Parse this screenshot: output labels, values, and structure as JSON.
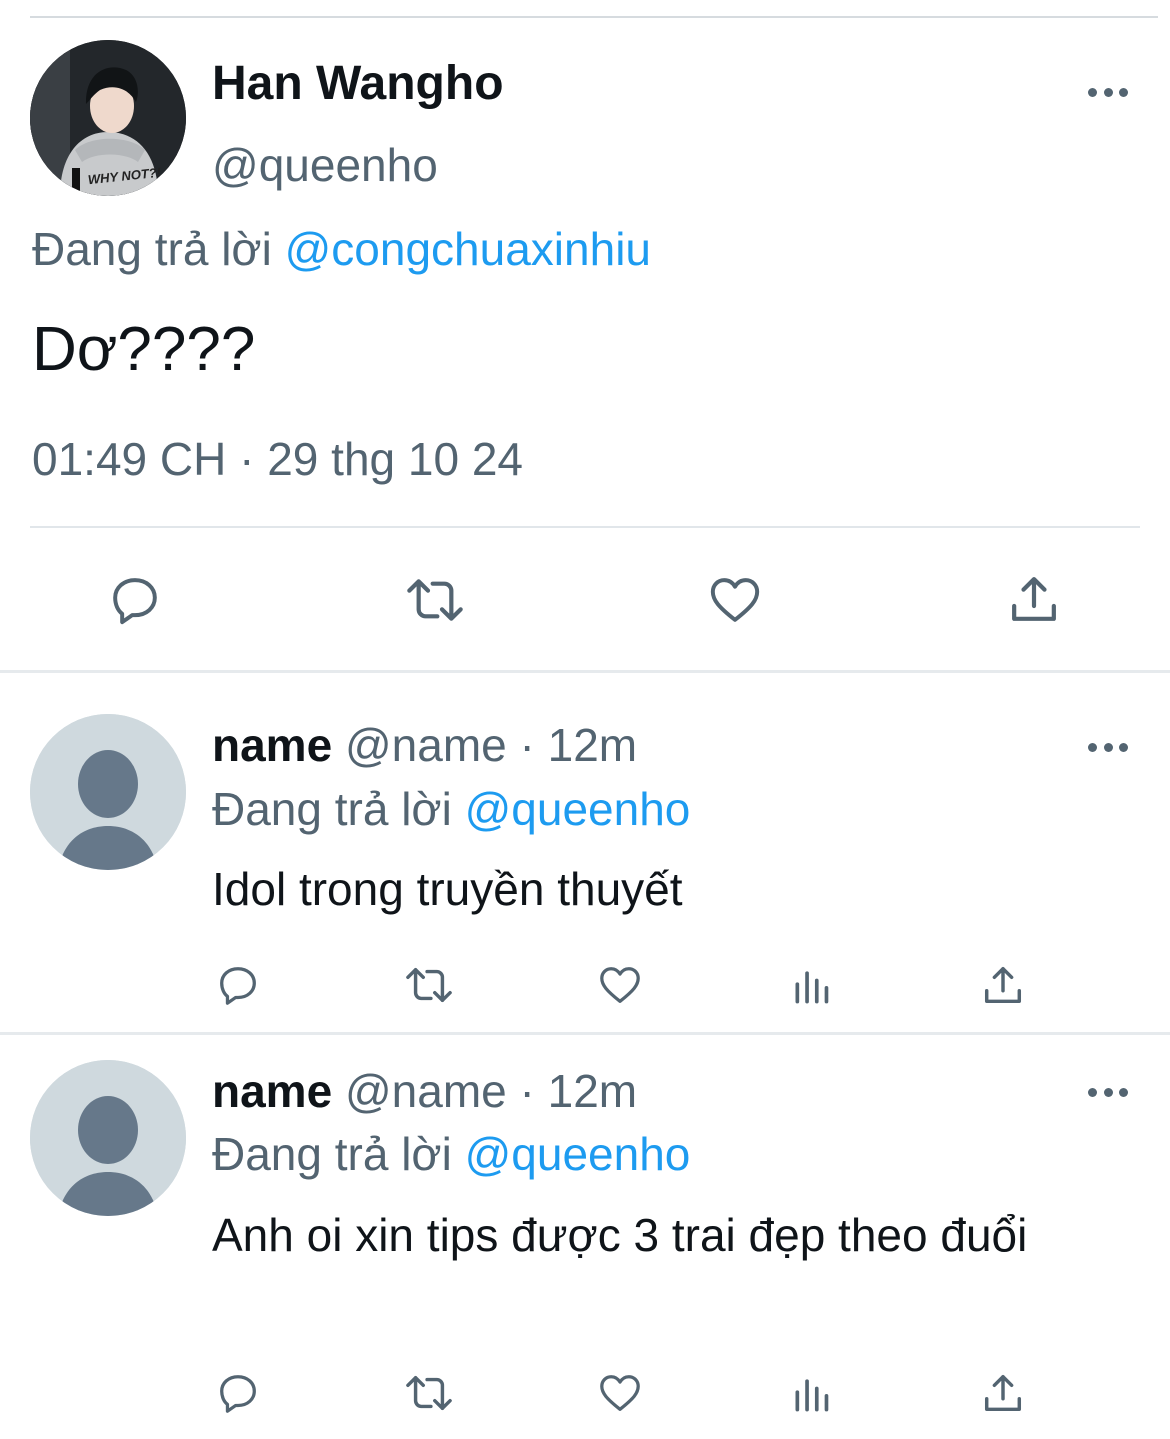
{
  "main_tweet": {
    "display_name": "Han Wangho",
    "handle": "@queenho",
    "replying_prefix": "Đang trả lời",
    "replying_to": "@congchuaxinhiu",
    "text": "Dơ????",
    "timestamp": "01:49 CH · 29 thg 10 24",
    "avatar_shirt_text": "WHY NOT?!",
    "actions": [
      "reply-icon",
      "retweet-icon",
      "like-icon",
      "share-icon"
    ]
  },
  "replies": [
    {
      "display_name": "name",
      "handle": "@name",
      "separator": "·",
      "time": "12m",
      "replying_prefix": "Đang trả lời",
      "replying_to": "@queenho",
      "text": "Idol trong truyền thuyết",
      "actions": [
        "reply-icon",
        "retweet-icon",
        "like-icon",
        "views-icon",
        "share-icon"
      ]
    },
    {
      "display_name": "name",
      "handle": "@name",
      "separator": "·",
      "time": "12m",
      "replying_prefix": "Đang trả lời",
      "replying_to": "@queenho",
      "text": "Anh oi xin tips được 3 trai đẹp theo đuổi",
      "actions": [
        "reply-icon",
        "retweet-icon",
        "like-icon",
        "views-icon",
        "share-icon"
      ]
    }
  ],
  "colors": {
    "text_primary": "#0f1419",
    "text_secondary": "#536471",
    "link": "#1d9bf0",
    "divider": "#e6eaed",
    "default_avatar_bg": "#cfd9de"
  }
}
